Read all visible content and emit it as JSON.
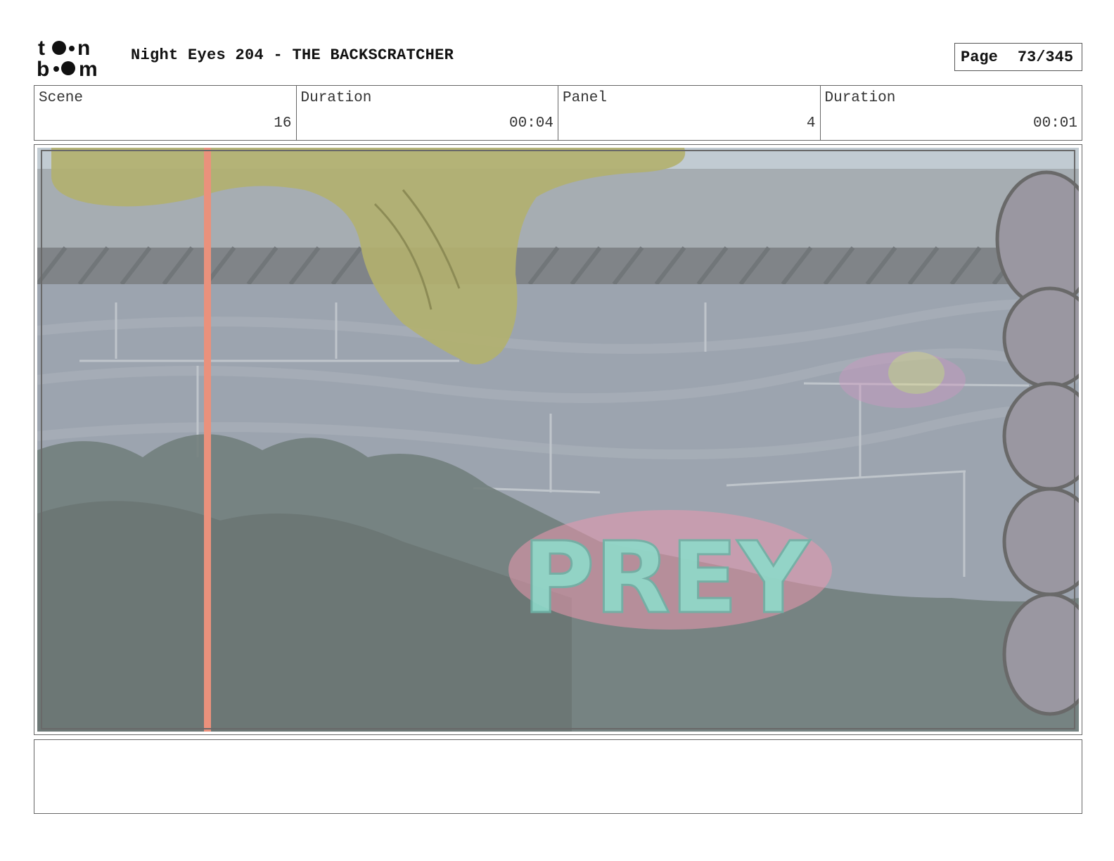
{
  "header": {
    "logo_text": "toon boom",
    "title": "Night Eyes 204 - THE BACKSCRATCHER",
    "page_label": "Page",
    "page_number": "73/345"
  },
  "info": {
    "scene_label": "Scene",
    "scene_value": "16",
    "scene_duration_label": "Duration",
    "scene_duration_value": "00:04",
    "panel_label": "Panel",
    "panel_value": "4",
    "panel_duration_label": "Duration",
    "panel_duration_value": "00:01"
  },
  "panel": {
    "graffiti_text": "PREY",
    "colors": {
      "wall": "#8f98a4",
      "sky": "#b9c4cc",
      "slime": "#a8a65a",
      "foliage": "#5f6e6c",
      "guide_line": "#e8826a",
      "graffiti_cyan": "#7fd6c4",
      "graffiti_pink": "#e88aa4"
    }
  },
  "notes": {
    "text": ""
  }
}
